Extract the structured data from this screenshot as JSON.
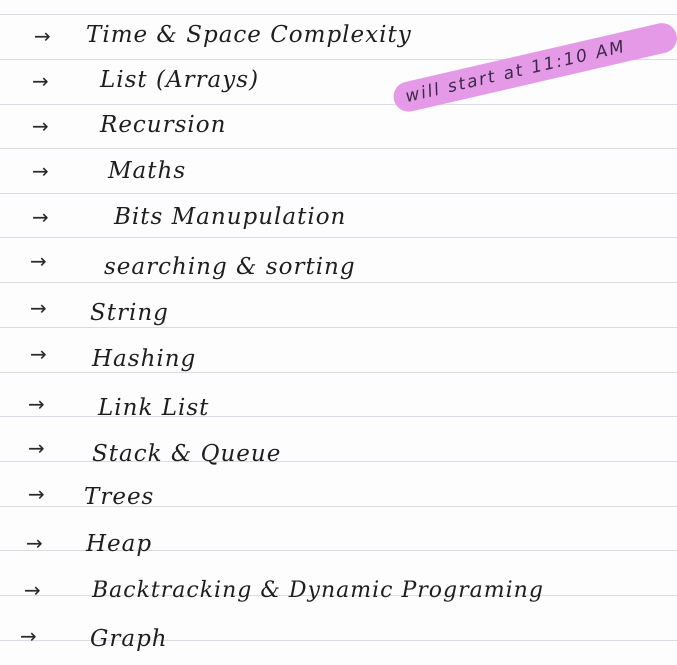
{
  "note": {
    "items": [
      {
        "arrow": "→",
        "label": "Time  &  Space    Complexity"
      },
      {
        "arrow": "→",
        "label": "List  (Arrays)"
      },
      {
        "arrow": "→",
        "label": "Recursion"
      },
      {
        "arrow": "→",
        "label": "Maths"
      },
      {
        "arrow": "→",
        "label": "Bits  Manupulation"
      },
      {
        "arrow": "→",
        "label": "searching  &  sorting"
      },
      {
        "arrow": "→",
        "label": "String"
      },
      {
        "arrow": "→",
        "label": "Hashing"
      },
      {
        "arrow": "→",
        "label": "Link List"
      },
      {
        "arrow": "→",
        "label": "Stack  &  Queue"
      },
      {
        "arrow": "→",
        "label": "Trees"
      },
      {
        "arrow": "→",
        "label": "Heap"
      },
      {
        "arrow": "→",
        "label": "Backtracking  &  Dynamic  Programing"
      },
      {
        "arrow": "→",
        "label": "Graph"
      }
    ],
    "highlight_text": "will  start  at  11:10 AM"
  },
  "colors": {
    "paper": "#fdfdfd",
    "rule_line": "#d9dde3",
    "ink": "#1e1e1e",
    "highlighter": "#e59ae8"
  }
}
